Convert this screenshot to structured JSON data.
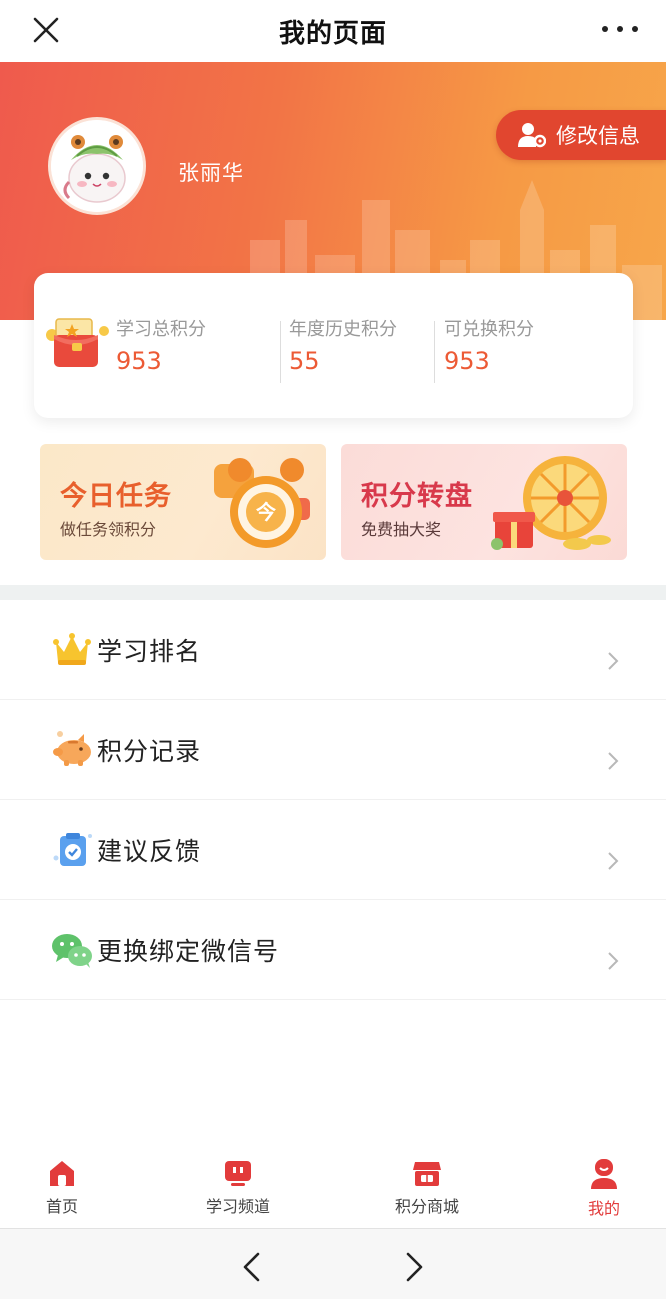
{
  "topbar": {
    "title": "我的页面"
  },
  "profile": {
    "username": "张丽华",
    "edit_label": "修改信息"
  },
  "points": [
    {
      "label": "学习总积分",
      "value": "953"
    },
    {
      "label": "年度历史积分",
      "value": "55"
    },
    {
      "label": "可兑换积分",
      "value": "953"
    }
  ],
  "promos": {
    "task": {
      "title": "今日任务",
      "subtitle": "做任务领积分",
      "badge": "今"
    },
    "wheel": {
      "title": "积分转盘",
      "subtitle": "免费抽大奖"
    }
  },
  "menu": [
    {
      "label": "学习排名",
      "icon": "crown-icon"
    },
    {
      "label": "积分记录",
      "icon": "piggy-bank-icon"
    },
    {
      "label": "建议反馈",
      "icon": "feedback-clipboard-icon"
    },
    {
      "label": "更换绑定微信号",
      "icon": "wechat-icon"
    }
  ],
  "tabs": [
    {
      "label": "首页",
      "icon": "home-icon"
    },
    {
      "label": "学习频道",
      "icon": "tv-icon"
    },
    {
      "label": "积分商城",
      "icon": "store-icon"
    },
    {
      "label": "我的",
      "icon": "user-icon",
      "active": true
    }
  ],
  "colors": {
    "accent": "#e23b3b",
    "points_value": "#ec5a35",
    "banner_start": "#ef5a4d",
    "banner_end": "#f7a64a"
  }
}
